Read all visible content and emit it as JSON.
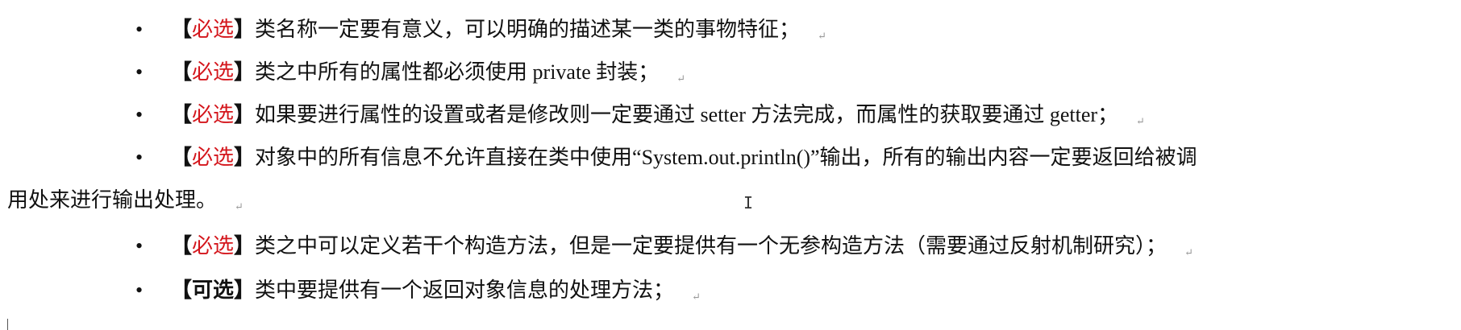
{
  "return_mark": "↵",
  "items": [
    {
      "tag": "必选",
      "text": "类名称一定要有意义，可以明确的描述某一类的事物特征；"
    },
    {
      "tag": "必选",
      "text": "类之中所有的属性都必须使用 private 封装；"
    },
    {
      "tag": "必选",
      "text": "如果要进行属性的设置或者是修改则一定要通过 setter 方法完成，而属性的获取要通过 getter；"
    },
    {
      "tag": "必选",
      "text": "对象中的所有信息不允许直接在类中使用“System.out.println()”输出，所有的输出内容一定要返回给被调",
      "continuation": "用处来进行输出处理。"
    },
    {
      "tag": "必选",
      "text": "类之中可以定义若干个构造方法，但是一定要提供有一个无参构造方法（需要通过反射机制研究）；"
    },
    {
      "tag": "可选",
      "text": "类中要提供有一个返回对象信息的处理方法；"
    }
  ],
  "bullet": "•",
  "bracket_open": "【",
  "bracket_close": "】",
  "cursor": "I"
}
